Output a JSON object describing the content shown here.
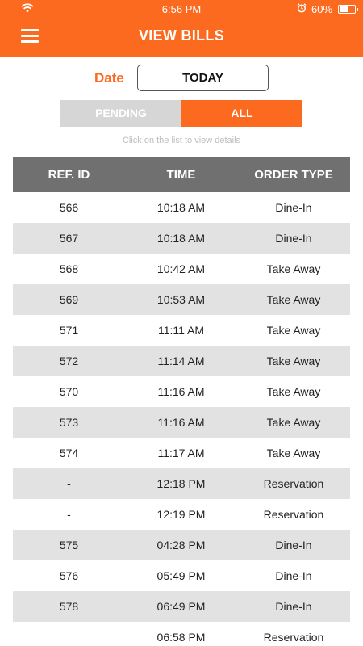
{
  "status_bar": {
    "time": "6:56 PM",
    "battery_percent": "60%",
    "battery_level": 0.6
  },
  "header": {
    "title": "VIEW BILLS",
    "menu_icon": "hamburger-menu-icon",
    "color": "#fb6a1e"
  },
  "date_filter": {
    "label": "Date",
    "value": "TODAY"
  },
  "tabs": [
    {
      "label": "PENDING",
      "active": false
    },
    {
      "label": "ALL",
      "active": true
    }
  ],
  "hint": "Click on the list to view details",
  "table": {
    "headers": [
      "REF. ID",
      "TIME",
      "ORDER TYPE"
    ],
    "rows": [
      [
        "566",
        "10:18 AM",
        "Dine-In"
      ],
      [
        "567",
        "10:18 AM",
        "Dine-In"
      ],
      [
        "568",
        "10:42 AM",
        "Take Away"
      ],
      [
        "569",
        "10:53 AM",
        "Take Away"
      ],
      [
        "571",
        "11:11 AM",
        "Take Away"
      ],
      [
        "572",
        "11:14 AM",
        "Take Away"
      ],
      [
        "570",
        "11:16 AM",
        "Take Away"
      ],
      [
        "573",
        "11:16 AM",
        "Take Away"
      ],
      [
        "574",
        "11:17 AM",
        "Take Away"
      ],
      [
        "-",
        "12:18 PM",
        "Reservation"
      ],
      [
        "-",
        "12:19 PM",
        "Reservation"
      ],
      [
        "575",
        "04:28 PM",
        "Dine-In"
      ],
      [
        "576",
        "05:49 PM",
        "Dine-In"
      ],
      [
        "578",
        "06:49 PM",
        "Dine-In"
      ],
      [
        "",
        "06:58 PM",
        "Reservation"
      ]
    ]
  }
}
